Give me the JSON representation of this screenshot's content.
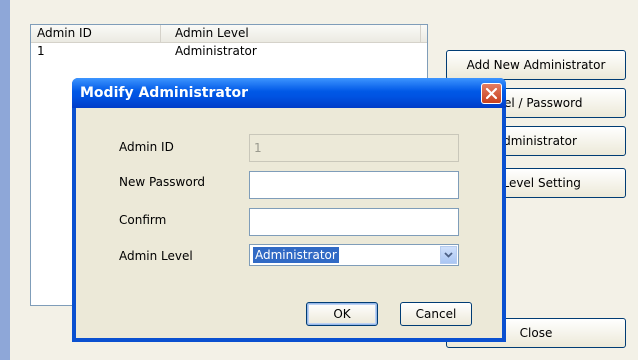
{
  "listview": {
    "columns": [
      "Admin ID",
      "Admin Level"
    ],
    "rows": [
      {
        "id": "1",
        "level": "Administrator"
      }
    ]
  },
  "buttons": {
    "add_new": "Add New Administrator",
    "modify_partial": "evel / Password",
    "delete_partial": "Administrator",
    "level_setting_partial": "n Level Setting",
    "close": "Close"
  },
  "dialog": {
    "title": "Modify Administrator",
    "labels": {
      "admin_id": "Admin ID",
      "new_password": "New Password",
      "confirm": "Confirm",
      "admin_level": "Admin Level"
    },
    "admin_id_value": "1",
    "new_password_value": "",
    "confirm_value": "",
    "admin_level_value": "Administrator",
    "ok": "OK",
    "cancel": "Cancel"
  },
  "icons": {
    "close": "close-icon",
    "dropdown": "chevron-down-icon"
  }
}
